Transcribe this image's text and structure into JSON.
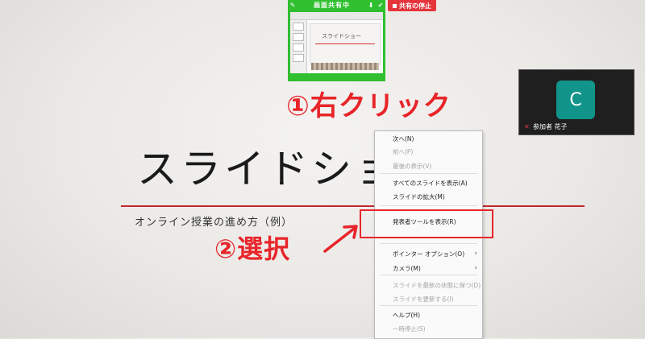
{
  "share_bar": {
    "label": "画面共有中",
    "left_icon": "pin-icon",
    "mid_icon": "pointer-icon",
    "right_icon": "check-icon",
    "stop_label": "共有の停止",
    "color": "#2fbf2f",
    "stop_color": "#e5343b"
  },
  "thumbnail": {
    "slide_title": "スライドショー"
  },
  "participant": {
    "initial": "C",
    "name": "参加者 花子",
    "avatar_color": "#11948a"
  },
  "annotations": {
    "step1": "①右クリック",
    "step2": "②選択",
    "color": "#e8252a"
  },
  "slide": {
    "title": "スライドショー",
    "subtitle": "オンライン授業の進め方（例）"
  },
  "context_menu": {
    "items": [
      {
        "label": "次へ(N)",
        "disabled": false
      },
      {
        "label": "前へ(P)",
        "disabled": true
      },
      {
        "label": "最後の表示(V)",
        "disabled": true
      },
      {
        "label": "すべてのスライドを表示(A)",
        "disabled": false
      },
      {
        "label": "スライドの拡大(M)",
        "disabled": false
      },
      {
        "label": "発表者ツールを表示(R)",
        "disabled": false
      },
      {
        "label": "ポインター オプション(O)",
        "disabled": false,
        "submenu": true
      },
      {
        "label": "カメラ(M)",
        "disabled": false,
        "submenu": true
      },
      {
        "label": "スライドを最新の状態に保つ(D)",
        "disabled": true
      },
      {
        "label": "スライドを更新する(I)",
        "disabled": true
      },
      {
        "label": "ヘルプ(H)",
        "disabled": false
      },
      {
        "label": "一時停止(S)",
        "disabled": true
      }
    ],
    "submenu_glyph": "›"
  }
}
